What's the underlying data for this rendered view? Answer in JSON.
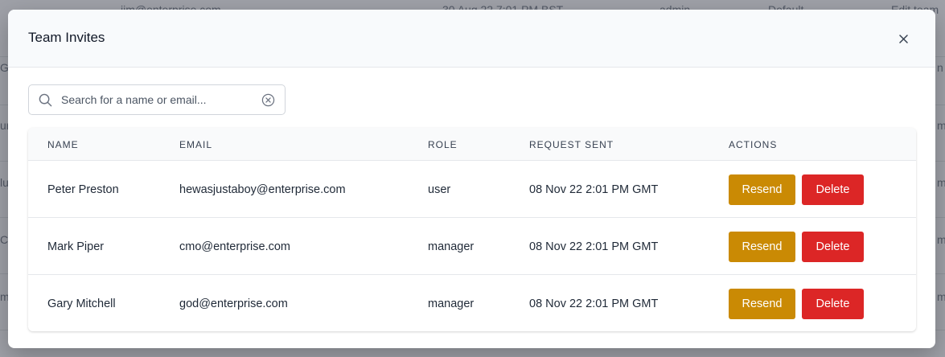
{
  "modal": {
    "title": "Team Invites",
    "close_label": "×"
  },
  "search": {
    "placeholder": "Search for a name or email...",
    "value": ""
  },
  "table": {
    "columns": [
      "NAME",
      "EMAIL",
      "ROLE",
      "REQUEST SENT",
      "ACTIONS"
    ],
    "rows": [
      {
        "name": "Peter Preston",
        "email": "hewasjustaboy@enterprise.com",
        "role": "user",
        "sent": "08 Nov 22 2:01 PM GMT"
      },
      {
        "name": "Mark Piper",
        "email": "cmo@enterprise.com",
        "role": "manager",
        "sent": "08 Nov 22 2:01 PM GMT"
      },
      {
        "name": "Gary Mitchell",
        "email": "god@enterprise.com",
        "role": "manager",
        "sent": "08 Nov 22 2:01 PM GMT"
      }
    ],
    "resend_label": "Resend",
    "delete_label": "Delete"
  },
  "background": {
    "email": "jim@enterprise.com",
    "date": "30 Aug 22 7:01 PM BST",
    "role": "admin",
    "team": "Default",
    "action": "Edit team",
    "left_fragments": [
      "Gi",
      "ur",
      "lu",
      "C",
      "m"
    ],
    "right_fragments": [
      "n",
      "m",
      "m",
      "m",
      "m"
    ]
  },
  "colors": {
    "resend": "#ca8a04",
    "delete": "#dc2626"
  },
  "icons": {
    "search": "search-icon",
    "clear": "clear-circle-icon",
    "close": "close-icon"
  }
}
